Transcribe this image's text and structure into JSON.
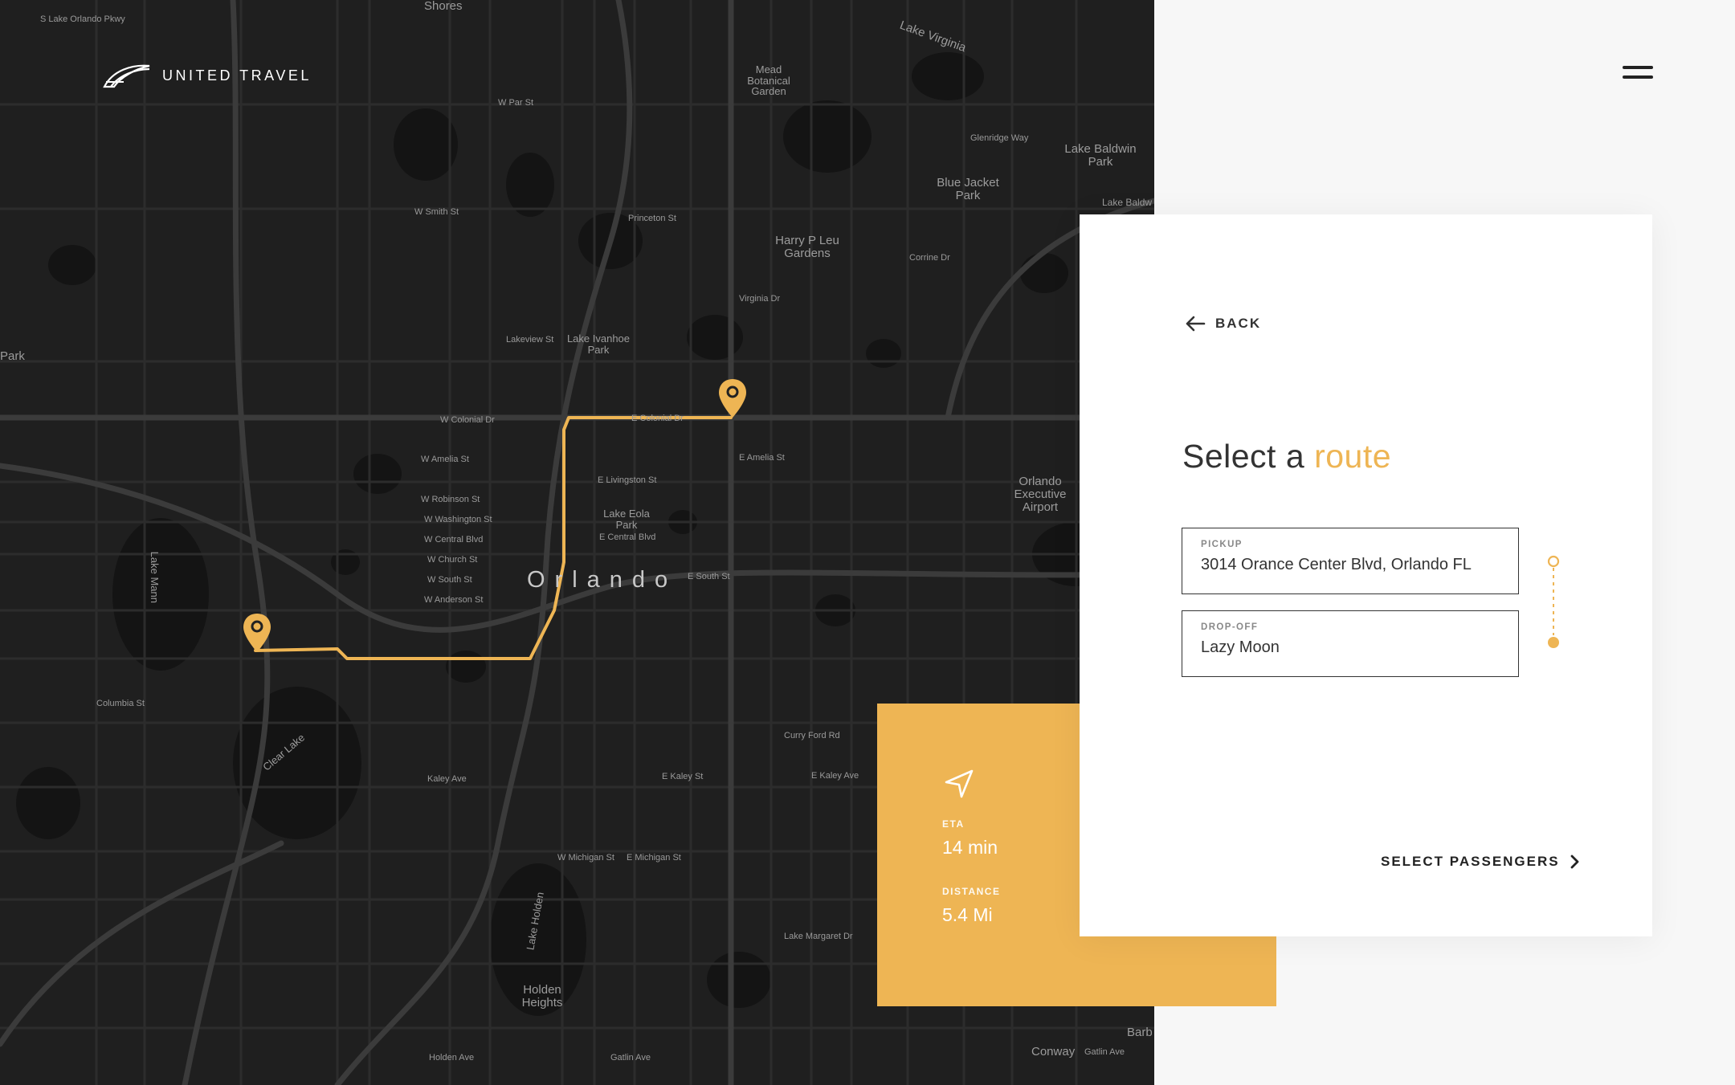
{
  "brand": {
    "name": "UNITED TRAVEL",
    "logo_icon": "wing-logo-icon"
  },
  "header": {
    "menu_icon": "hamburger-menu-icon"
  },
  "map": {
    "city_label": "Orlando",
    "area_labels": [
      "Shores",
      "Mead Botanical Garden",
      "Lake Virginia",
      "Lake Baldwin Park",
      "Blue Jacket Park",
      "Harry P Leu Gardens",
      "Lake Ivanhoe Park",
      "Lake Eola Park",
      "Orlando Executive Airport",
      "Lake Mann",
      "Clear Lake",
      "Lake Holden",
      "Holden Heights",
      "Conway",
      "Barb",
      "Park",
      "Lake Baldw"
    ],
    "street_labels": [
      "S Lake Orlando Pkwy",
      "W Par St",
      "Glenridge Way",
      "W Smith St",
      "Princeton St",
      "Corrine Dr",
      "Virginia Dr",
      "Lakeview St",
      "W Colonial Dr",
      "E Colonial Dr",
      "W Amelia St",
      "E Amelia St",
      "E Livingston St",
      "W Robinson St",
      "W Washington St",
      "W Central Blvd",
      "E Central Blvd",
      "W Church St",
      "W South St",
      "E South St",
      "W Anderson St",
      "Columbia St",
      "Kaley Ave",
      "E Kaley St",
      "Curry Ford Rd",
      "E Kaley Ave",
      "W Michigan St",
      "E Michigan St",
      "Lake Margaret Dr",
      "Holden Ave",
      "Gatlin Ave",
      "Gatlin Ave"
    ],
    "pin_icon": "map-pin-icon",
    "accent_color": "#eeb554",
    "background_color": "#1f1f1f"
  },
  "trip": {
    "nav_icon": "navigation-arrow-icon",
    "eta_label": "ETA",
    "eta_value": "14 min",
    "distance_label": "DISTANCE",
    "distance_value": "5.4 Mi"
  },
  "panel": {
    "back_icon": "arrow-left-icon",
    "back_label": "BACK",
    "title_prefix": "Select a",
    "title_accent": "route",
    "pickup": {
      "label": "PICKUP",
      "value": "3014 Orance Center Blvd, Orlando FL"
    },
    "dropoff": {
      "label": "DROP-OFF",
      "value": "Lazy Moon"
    },
    "next_label": "SELECT PASSENGERS",
    "next_icon": "chevron-right-icon"
  }
}
